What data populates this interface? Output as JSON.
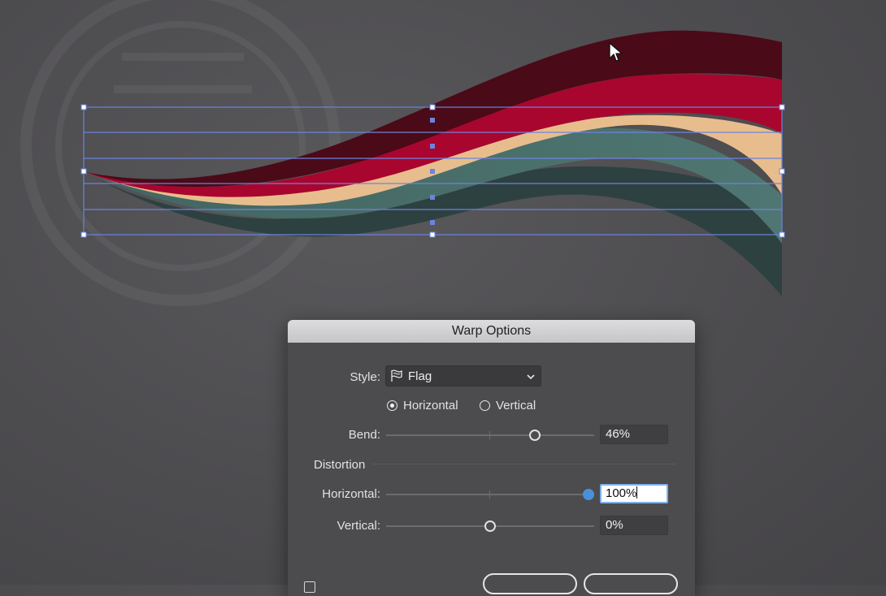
{
  "dialog": {
    "title": "Warp Options",
    "style_label": "Style:",
    "style_value": "Flag",
    "style_icon": "flag-warp-icon",
    "orientation": {
      "horizontal_label": "Horizontal",
      "vertical_label": "Vertical",
      "selected": "Horizontal"
    },
    "bend": {
      "label": "Bend:",
      "value": "46%"
    },
    "distortion": {
      "heading": "Distortion",
      "horizontal": {
        "label": "Horizontal:",
        "value": "100%"
      },
      "vertical": {
        "label": "Vertical:",
        "value": "0%"
      }
    }
  },
  "colors": {
    "wave_top": "#4a0a18",
    "wave_red": "#a8062e",
    "wave_peach": "#e8bd8e",
    "wave_teal": "#4d7470",
    "wave_dark": "#2d4140",
    "selection": "#6b84e0",
    "accent": "#4a90d9"
  }
}
